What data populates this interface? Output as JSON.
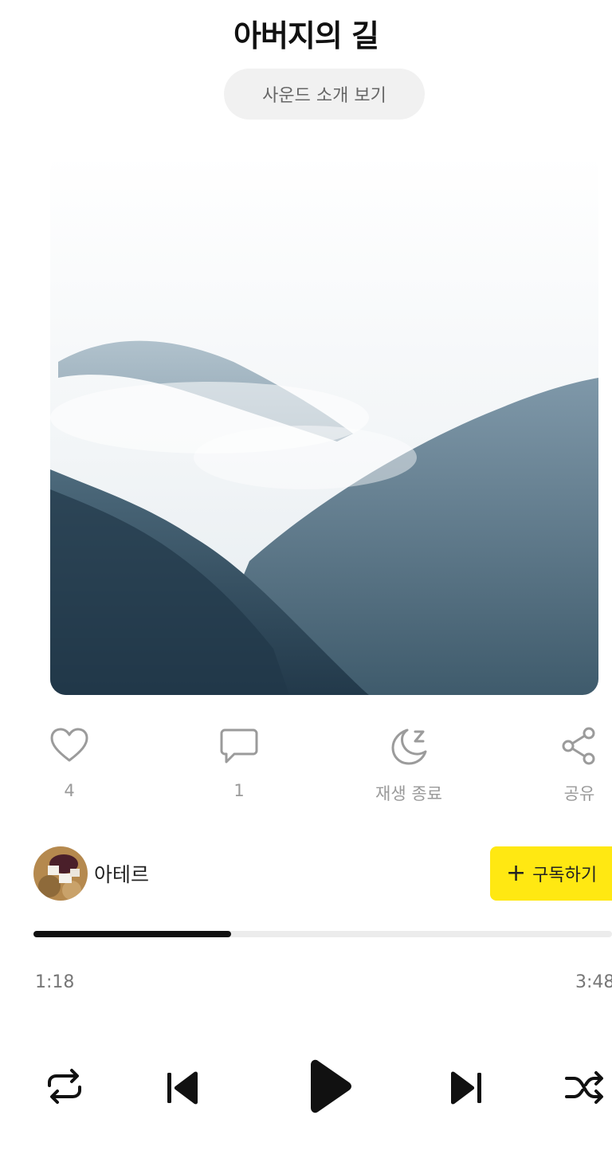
{
  "track": {
    "title": "아버지의 길"
  },
  "intro_button": {
    "label": "사운드 소개 보기"
  },
  "cover": {
    "description": "misty-mountains-artwork"
  },
  "actions": [
    {
      "icon": "heart-icon",
      "label": "4"
    },
    {
      "icon": "comment-icon",
      "label": "1"
    },
    {
      "icon": "sleep-timer-icon",
      "label": "재생 종료"
    },
    {
      "icon": "share-icon",
      "label": "공유"
    }
  ],
  "author": {
    "name": "아테르",
    "subscribe_label": "구독하기"
  },
  "player": {
    "current_time": "1:18",
    "total_time": "3:48",
    "progress_fraction": 0.342
  },
  "controls": {
    "repeat": "repeat-icon",
    "previous": "skip-previous-icon",
    "play": "play-icon",
    "next": "skip-next-icon",
    "shuffle": "shuffle-icon"
  },
  "colors": {
    "accent": "#ffe812",
    "progress": "#111111"
  }
}
